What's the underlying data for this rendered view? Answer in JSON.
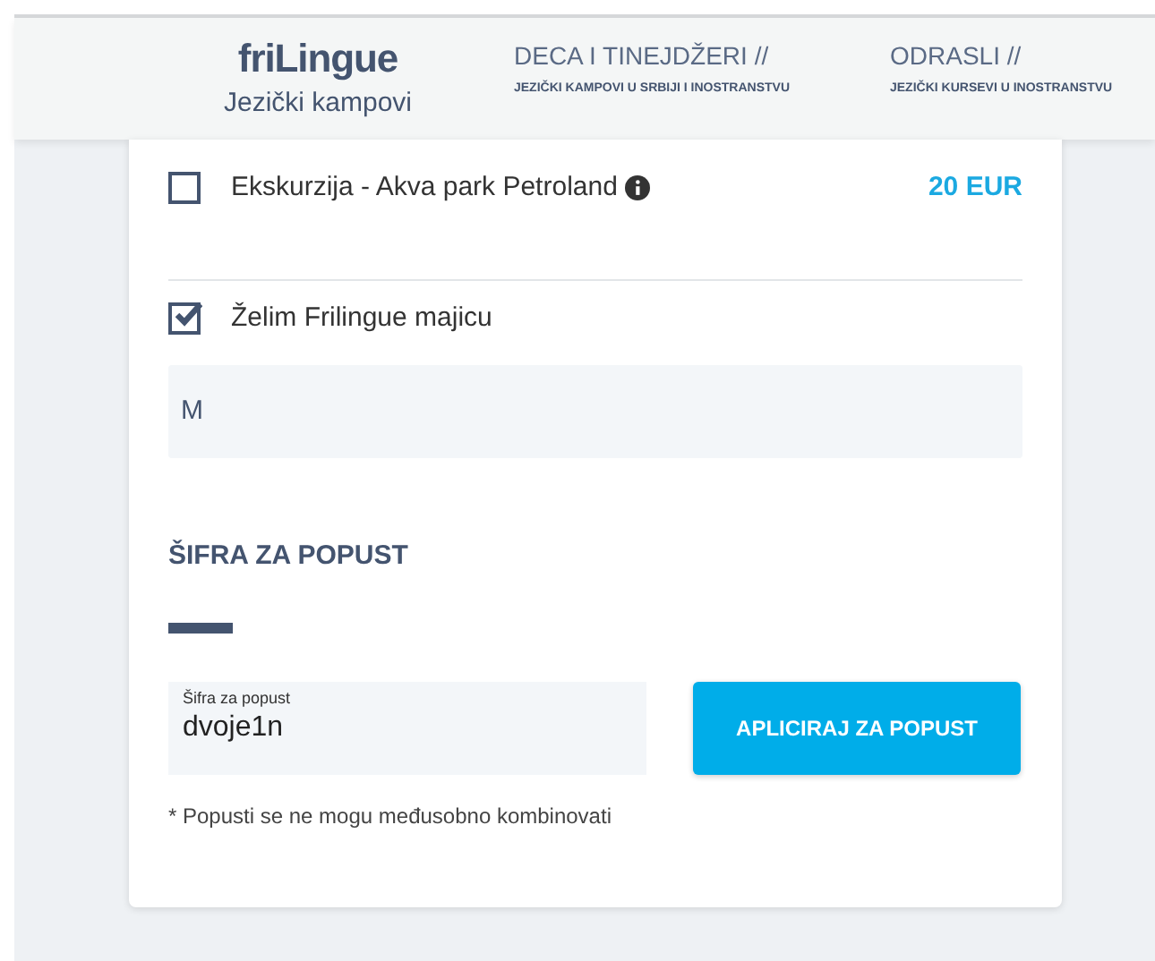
{
  "header": {
    "logo": "friLingue",
    "tagline": "Jezički kampovi",
    "nav": [
      {
        "title": "DECA I TINEJDŽERI //",
        "subtitle": "JEZIČKI KAMPOVI U SRBIJI I INOSTRANSTVU"
      },
      {
        "title": "ODRASLI //",
        "subtitle": "JEZIČKI KURSEVI U INOSTRANSTVU"
      }
    ]
  },
  "options": [
    {
      "label": "Ekskurzija - Akva park Petroland",
      "checked": false,
      "price": "20 EUR",
      "info": true
    },
    {
      "label": "Želim Frilingue majicu",
      "checked": true,
      "info": false
    }
  ],
  "shirt_size": {
    "value": "M"
  },
  "discount": {
    "heading": "ŠIFRA ZA POPUST",
    "field_label": "Šifra za popust",
    "value": "dvoje1n",
    "button": "APLICIRAJ ZA POPUST",
    "note": "* Popusti se ne mogu međusobno kombinovati"
  }
}
